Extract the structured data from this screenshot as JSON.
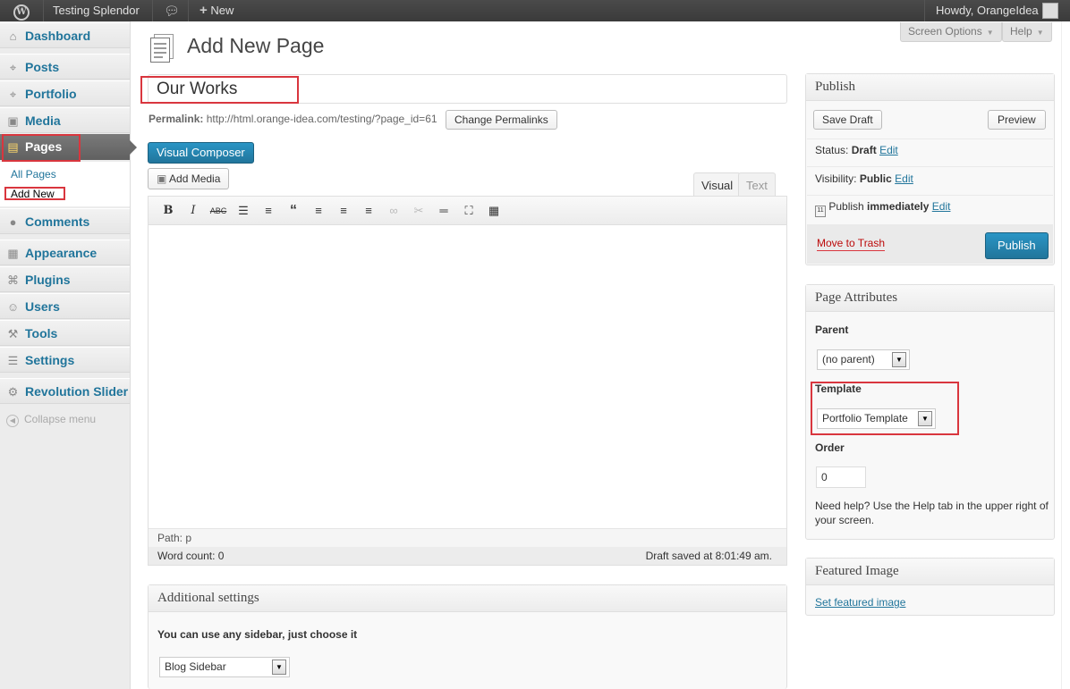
{
  "admin_bar": {
    "site_name": "Testing Splendor",
    "new_label": "New",
    "greeting": "Howdy, OrangeIdea"
  },
  "sidebar": {
    "items": [
      {
        "label": "Dashboard",
        "icon": "dashboard-icon"
      },
      {
        "label": "Posts",
        "icon": "pin-icon"
      },
      {
        "label": "Portfolio",
        "icon": "pin-icon"
      },
      {
        "label": "Media",
        "icon": "media-icon"
      },
      {
        "label": "Pages",
        "icon": "pages-icon"
      },
      {
        "label": "Comments",
        "icon": "comments-icon"
      },
      {
        "label": "Appearance",
        "icon": "appearance-icon"
      },
      {
        "label": "Plugins",
        "icon": "plugins-icon"
      },
      {
        "label": "Users",
        "icon": "users-icon"
      },
      {
        "label": "Tools",
        "icon": "tools-icon"
      },
      {
        "label": "Settings",
        "icon": "settings-icon"
      },
      {
        "label": "Revolution Slider",
        "icon": "gear-icon"
      }
    ],
    "submenu": [
      "All Pages",
      "Add New"
    ],
    "collapse_label": "Collapse menu"
  },
  "header": {
    "title": "Add New Page",
    "screen_options": "Screen Options",
    "help": "Help"
  },
  "post": {
    "title_value": "Our Works",
    "permalink_label": "Permalink:",
    "permalink_url": "http://html.orange-idea.com/testing/?page_id=61",
    "change_permalinks": "Change Permalinks",
    "visual_composer": "Visual Composer",
    "add_media": "Add Media",
    "tab_visual": "Visual",
    "tab_text": "Text",
    "path": "Path: p",
    "word_count": "Word count: 0",
    "draft_saved": "Draft saved at 8:01:49 am."
  },
  "additional": {
    "title": "Additional settings",
    "sidebar_hint": "You can use any sidebar, just choose it",
    "sidebar_value": "Blog Sidebar"
  },
  "publish": {
    "title": "Publish",
    "save_draft": "Save Draft",
    "preview": "Preview",
    "status_label": "Status:",
    "status_value": "Draft",
    "visibility_label": "Visibility:",
    "visibility_value": "Public",
    "publish_label": "Publish",
    "publish_when": "immediately",
    "edit": "Edit",
    "trash": "Move to Trash",
    "publish_button": "Publish"
  },
  "attributes": {
    "title": "Page Attributes",
    "parent_label": "Parent",
    "parent_value": "(no parent)",
    "template_label": "Template",
    "template_value": "Portfolio Template",
    "order_label": "Order",
    "order_value": "0",
    "help_text": "Need help? Use the Help tab in the upper right of your screen."
  },
  "featured": {
    "title": "Featured Image",
    "link": "Set featured image"
  },
  "colors": {
    "link": "#21759b",
    "highlight": "#d9363e",
    "primary": "#21759b"
  }
}
